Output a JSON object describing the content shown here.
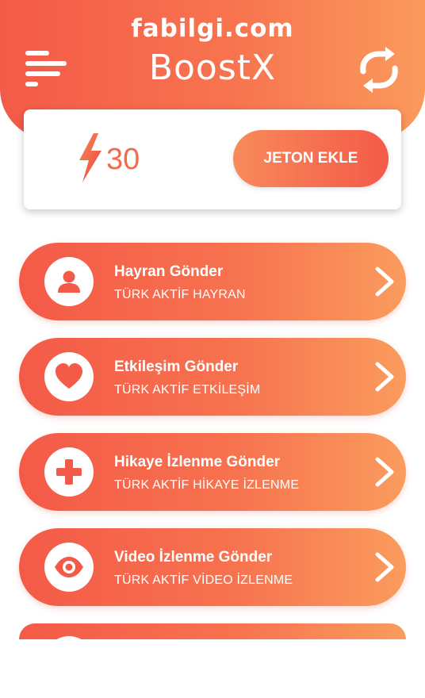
{
  "watermark": "fabilgi.com",
  "header": {
    "title": "BoostX",
    "menu_icon": "menu-icon",
    "refresh_icon": "refresh-icon"
  },
  "token_card": {
    "count": "30",
    "icon": "lightning-bolt-icon",
    "add_button_label": "JETON EKLE"
  },
  "services": [
    {
      "title": "Hayran Gönder",
      "subtitle": "TÜRK AKTİF HAYRAN",
      "icon": "user-icon"
    },
    {
      "title": "Etkileşim Gönder",
      "subtitle": "TÜRK AKTİF ETKİLEŞİM",
      "icon": "heart-icon"
    },
    {
      "title": "Hikaye İzlenme Gönder",
      "subtitle": "TÜRK AKTİF HİKAYE İZLENME",
      "icon": "plus-icon"
    },
    {
      "title": "Video İzlenme Gönder",
      "subtitle": "TÜRK AKTİF VİDEO İZLENME",
      "icon": "eye-icon"
    }
  ],
  "colors": {
    "accent": "#f45a48",
    "accent_light": "#fb9a5d",
    "token_text": "#f36b4d"
  }
}
